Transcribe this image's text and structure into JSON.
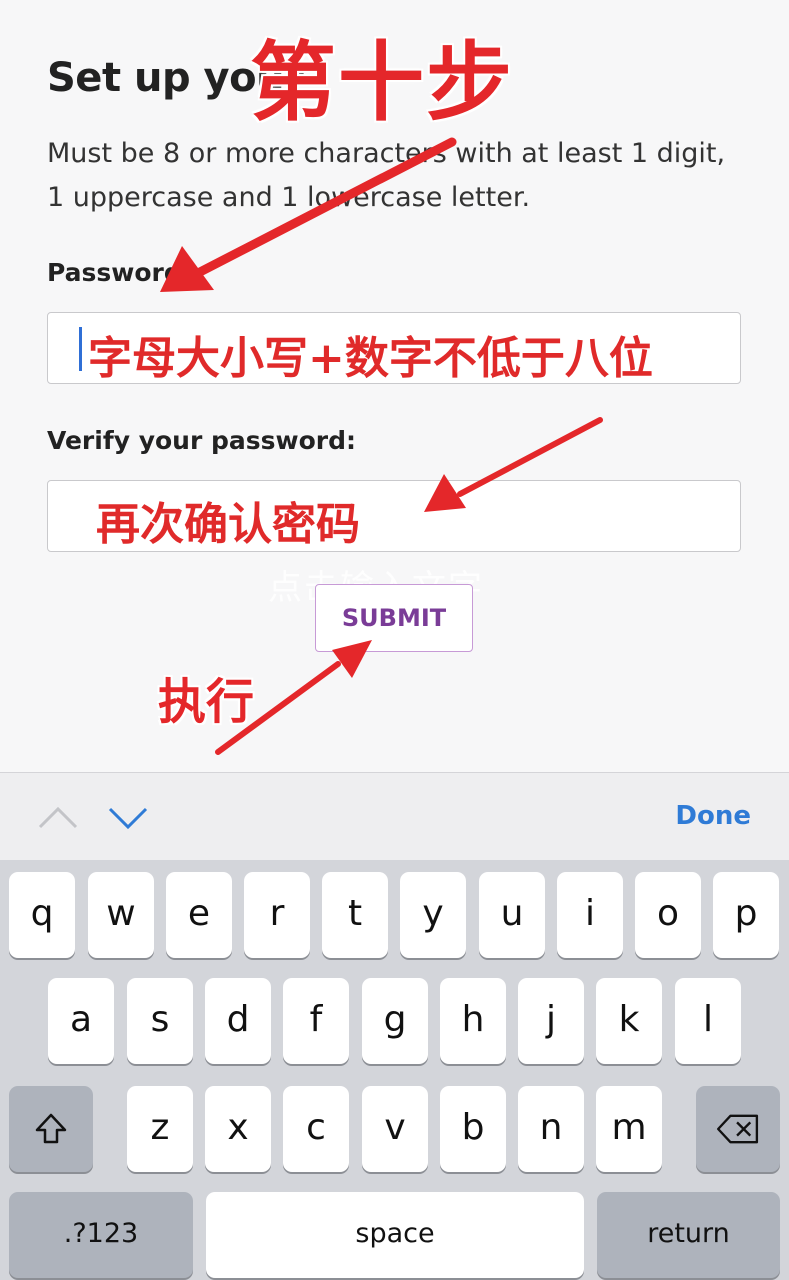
{
  "form": {
    "title": "Set up your",
    "description": "Must be 8 or more characters with at least 1 digit, 1 uppercase and 1 lowercase letter.",
    "password_label": "Password:",
    "verify_label": "Verify your password:",
    "submit_label": "SUBMIT"
  },
  "annotations": {
    "step_title": "第十步",
    "password_hint": "字母大小写+数字不低于八位",
    "verify_hint": "再次确认密码",
    "execute_hint": "执行",
    "watermark": "点击输入文字",
    "color": "#e4272a"
  },
  "toolbar": {
    "prev_icon": "chevron-up-icon",
    "next_icon": "chevron-down-icon",
    "done_label": "Done",
    "accent_color": "#2f7bd6"
  },
  "keyboard": {
    "row1": [
      "q",
      "w",
      "e",
      "r",
      "t",
      "y",
      "u",
      "i",
      "o",
      "p"
    ],
    "row2": [
      "a",
      "s",
      "d",
      "f",
      "g",
      "h",
      "j",
      "k",
      "l"
    ],
    "row3": [
      "z",
      "x",
      "c",
      "v",
      "b",
      "n",
      "m"
    ],
    "shift_icon": "shift-icon",
    "backspace_icon": "backspace-icon",
    "numbers_label": ".?123",
    "space_label": "space",
    "return_label": "return"
  }
}
